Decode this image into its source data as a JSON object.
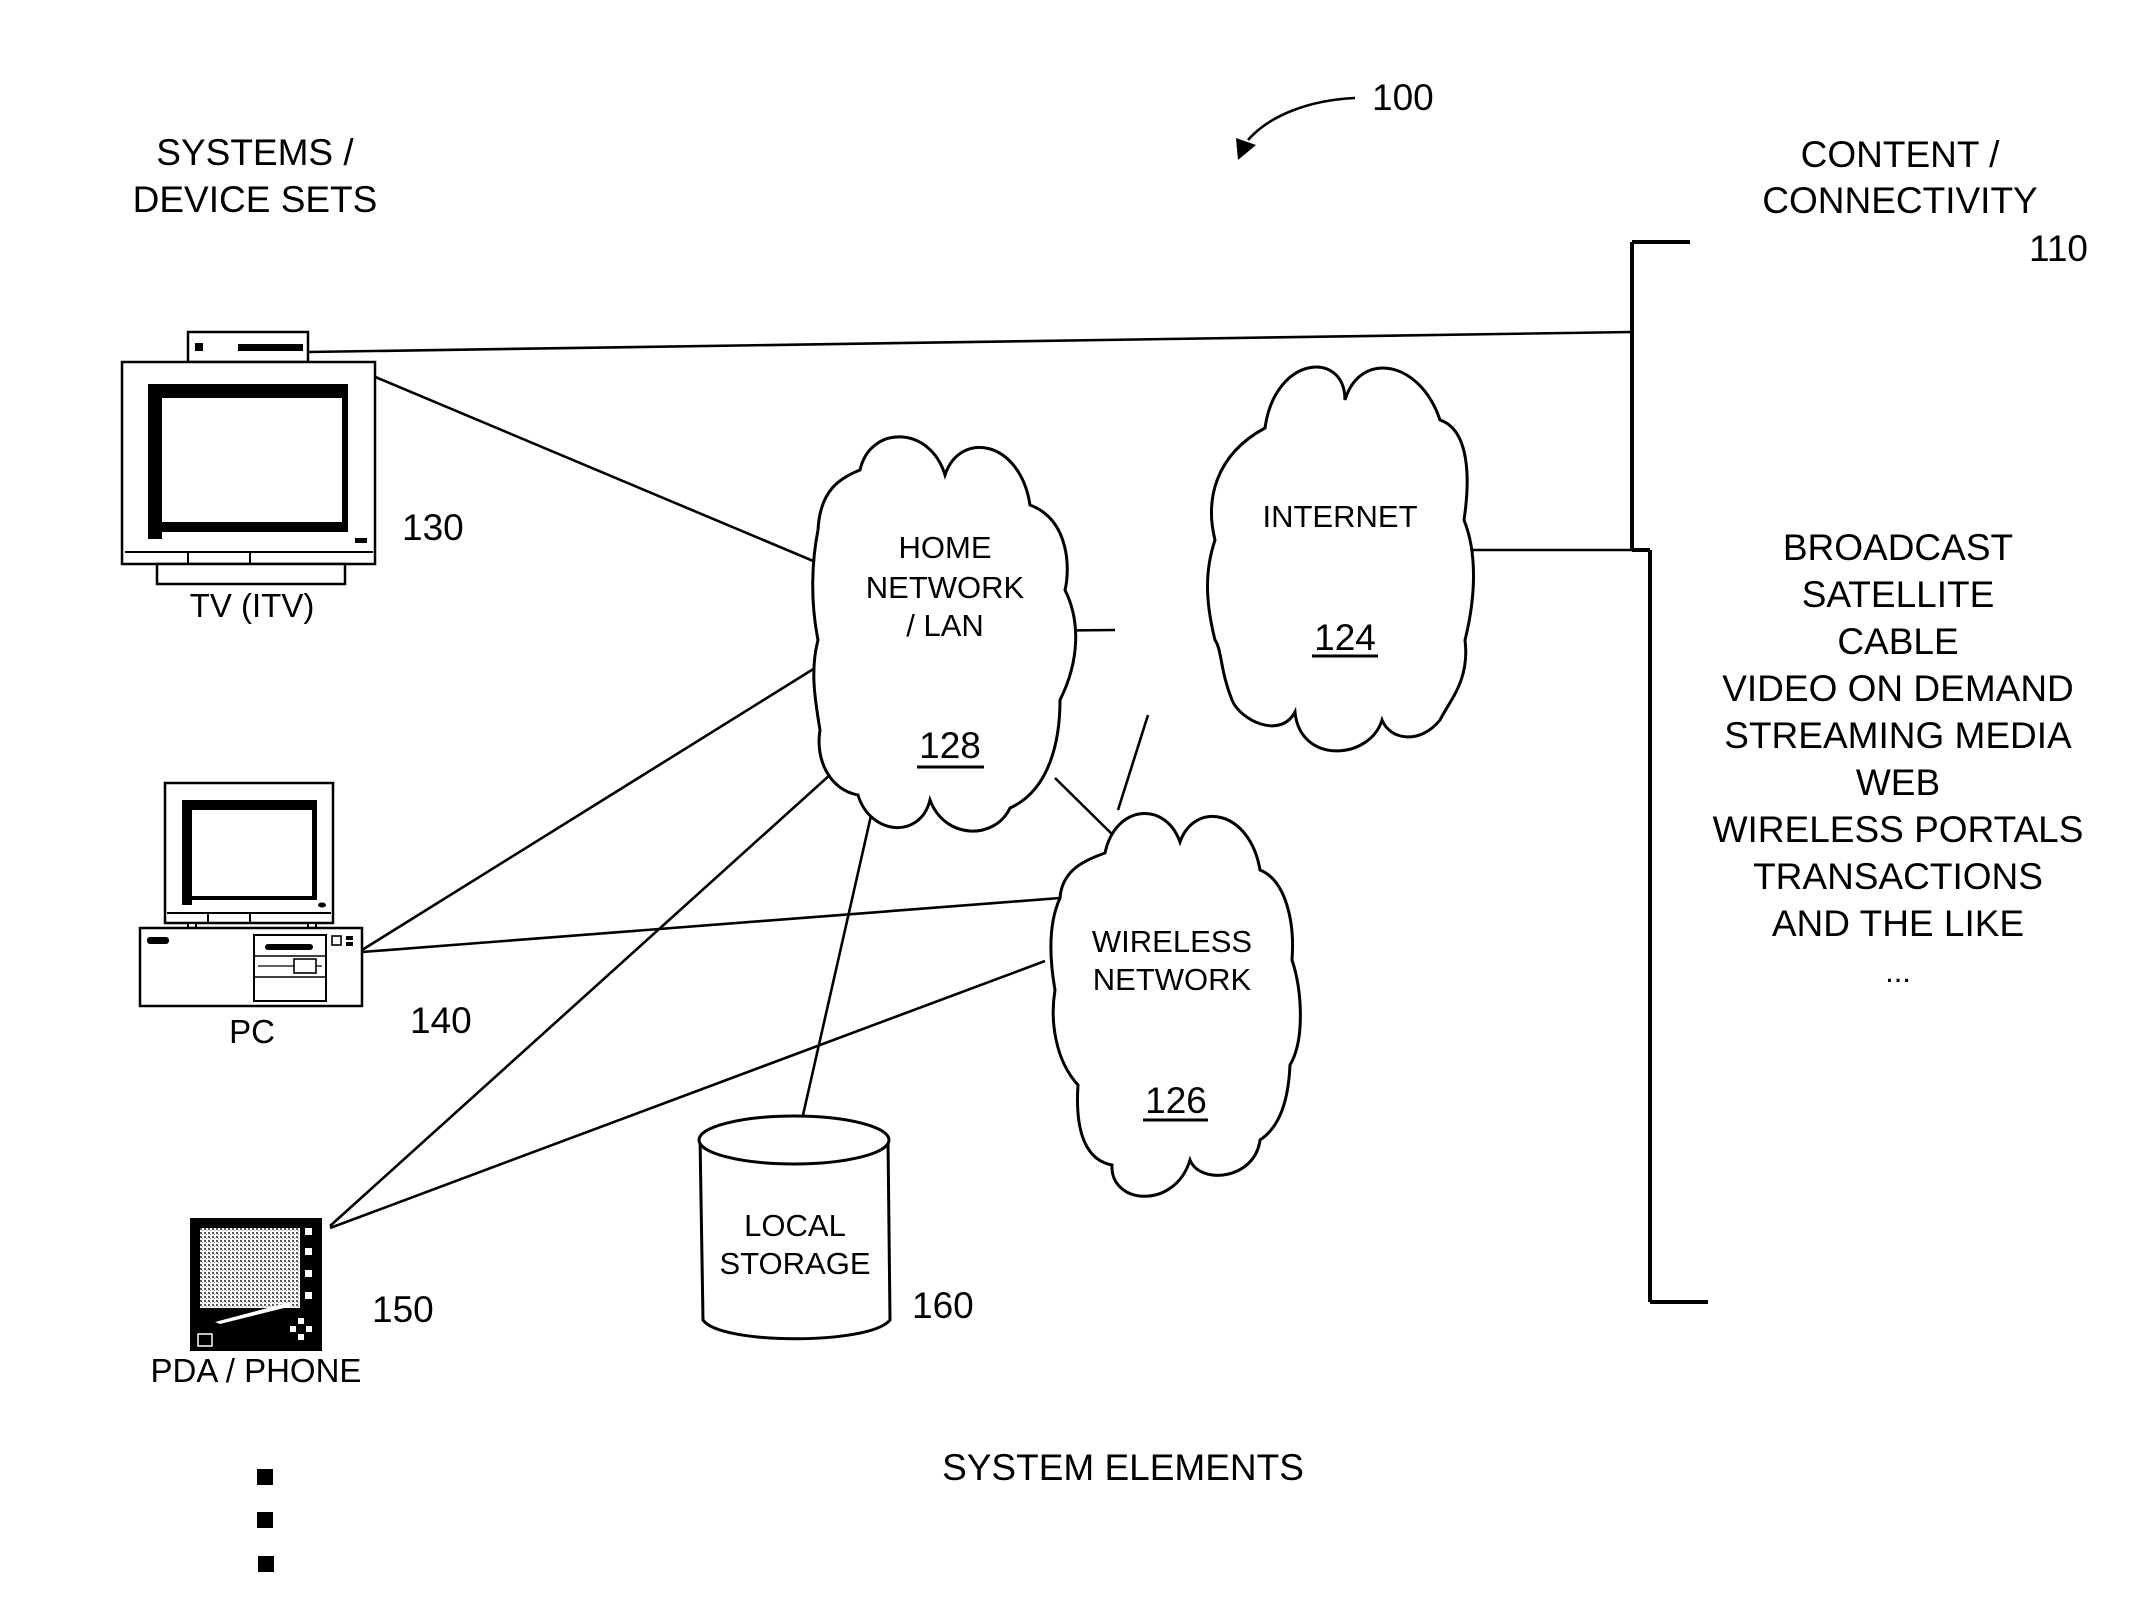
{
  "figure": {
    "reference_number": "100",
    "left_heading": [
      "SYSTEMS /",
      "DEVICE SETS"
    ],
    "right_heading": [
      "CONTENT /",
      "CONNECTIVITY"
    ],
    "right_heading_ref": "110",
    "bottom_caption": "SYSTEM ELEMENTS"
  },
  "devices": [
    {
      "id": "tv",
      "label": "TV (ITV)",
      "ref": "130",
      "icon": "television-icon"
    },
    {
      "id": "pc",
      "label": "PC",
      "ref": "140",
      "icon": "desktop-computer-icon"
    },
    {
      "id": "pda",
      "label": "PDA / PHONE",
      "ref": "150",
      "icon": "pda-phone-icon"
    }
  ],
  "networks": [
    {
      "id": "home",
      "label": [
        "HOME",
        "NETWORK",
        "/ LAN"
      ],
      "ref": "128"
    },
    {
      "id": "internet",
      "label": [
        "INTERNET"
      ],
      "ref": "124"
    },
    {
      "id": "wireless",
      "label": [
        "WIRELESS",
        "NETWORK"
      ],
      "ref": "126"
    }
  ],
  "storage": {
    "label": [
      "LOCAL",
      "STORAGE"
    ],
    "ref": "160"
  },
  "content_list": [
    "BROADCAST",
    "SATELLITE",
    "CABLE",
    "VIDEO ON DEMAND",
    "STREAMING MEDIA",
    "WEB",
    "WIRELESS PORTALS",
    "TRANSACTIONS",
    "AND THE LIKE",
    "..."
  ],
  "more_devices_marker": "vertical-ellipsis-squares"
}
